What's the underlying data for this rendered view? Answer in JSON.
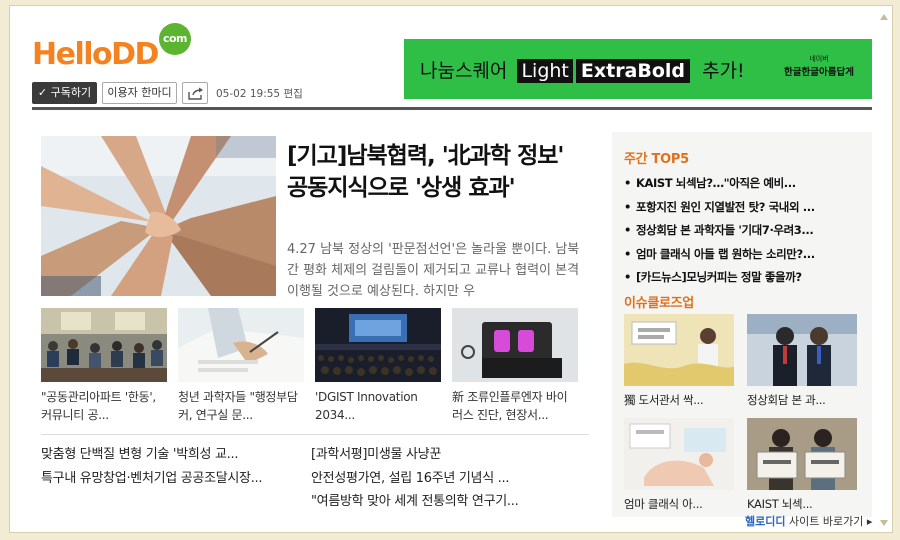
{
  "header": {
    "logo_text": "HelloDD",
    "logo_suffix": "com"
  },
  "banner": {
    "text_before": "나눔스퀘어",
    "light": "Light",
    "extrabold": "ExtraBold",
    "text_after": "추가!",
    "brand_small": "네이버",
    "brand": "한글한글아름답게"
  },
  "toolbar": {
    "subscribe_label": "✓ 구독하기",
    "opinion_label": "이용자 한마디",
    "date": "05-02 19:55 편집"
  },
  "feature": {
    "title": "[기고]남북협력, '北과학 정보' 공동지식으로 '상생 효과'",
    "summary": "4.27 남북 정상의 '판문점선언'은 놀라울 뿐이다. 남북간 평화 체제의 걸림돌이 제거되고 교류나 협력이 본격 이행될 것으로 예상된다. 하지만 우"
  },
  "thumbs": [
    {
      "caption": "\"공동관리아파트 '한동', 커뮤니티 공..."
    },
    {
      "caption": "청년 과학자들 \"행정부담 커, 연구실 문..."
    },
    {
      "caption": "'DGIST Innovation 2034..."
    },
    {
      "caption": "新 조류인플루엔자 바이러스 진단, 현장서..."
    }
  ],
  "list_left": [
    "맞춤형 단백질 변형 기술 '박희성 교...",
    "특구내 유망창업·벤처기업 공공조달시장..."
  ],
  "list_right": [
    "[과학서평]미생물 사냥꾼",
    "안전성평가연, 설립 16주년 기념식 ...",
    "\"여름방학 맞아 세계 전통의학 연구기..."
  ],
  "sidebar": {
    "top5_title": "주간 TOP5",
    "top5": [
      "KAIST 뇌섹남?…\"아직은 예비...",
      "포항지진 원인 지열발전 탓? 국내외 ...",
      "정상회담 본 과학자들 '기대7·우려3...",
      "엄마 클래식 아들 랩 원하는 소리만?...",
      "[카드뉴스]모닝커피는 정말 좋을까?"
    ],
    "closeup_title": "이슈클로즈업",
    "closeups": [
      {
        "caption": "獨 도서관서 싹..."
      },
      {
        "caption": "정상회담 본 과..."
      },
      {
        "caption": "엄마 클래식 아..."
      },
      {
        "caption": "KAIST 뇌섹..."
      }
    ]
  },
  "footer": {
    "brand": "헬로디디",
    "link": "사이트 바로가기 ▸"
  }
}
